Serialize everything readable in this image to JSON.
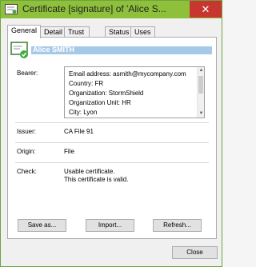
{
  "window": {
    "title": "Certificate [signature] of 'Alice S...",
    "close_glyph": "✕"
  },
  "tabs": [
    "General",
    "Detail",
    "Trust chain",
    "Status",
    "Uses"
  ],
  "subject": {
    "name": "Alice SMITH"
  },
  "fields": {
    "bearer_label": "Bearer:",
    "bearer_lines": [
      "Email address: asmith@mycompany.com",
      "Country: FR",
      "Organization: StormShield",
      "Organization Unit: HR",
      "City: Lyon"
    ],
    "issuer_label": "Issuer:",
    "issuer_value": "CA File 91",
    "origin_label": "Origin:",
    "origin_value": "File",
    "check_label": "Check:",
    "check_lines": [
      "Usable certificate.",
      "This certificate is valid."
    ]
  },
  "buttons": {
    "save_as": "Save as...",
    "import": "Import...",
    "refresh": "Refresh...",
    "close": "Close"
  },
  "icons": {
    "title": "certificate-icon",
    "subject": "certificate-valid-icon"
  },
  "colors": {
    "titlebar": "#8ec03b",
    "close_button": "#c7372f",
    "subject_highlight": "#a6c9e8"
  }
}
